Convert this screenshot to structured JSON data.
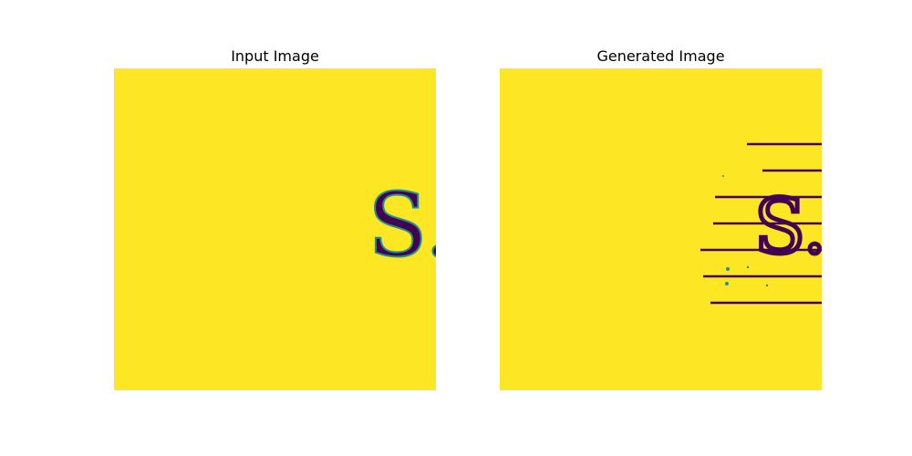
{
  "figure": {
    "panels": [
      {
        "title": "Input Image",
        "glyph_text": "S.",
        "background_color": "#fde725",
        "ink_color": "#440154",
        "edge_color": "#21918c"
      },
      {
        "title": "Generated Image",
        "glyph_text": "S.",
        "background_color": "#fde725",
        "ink_color": "#440154",
        "edge_color": "#21918c"
      }
    ]
  }
}
